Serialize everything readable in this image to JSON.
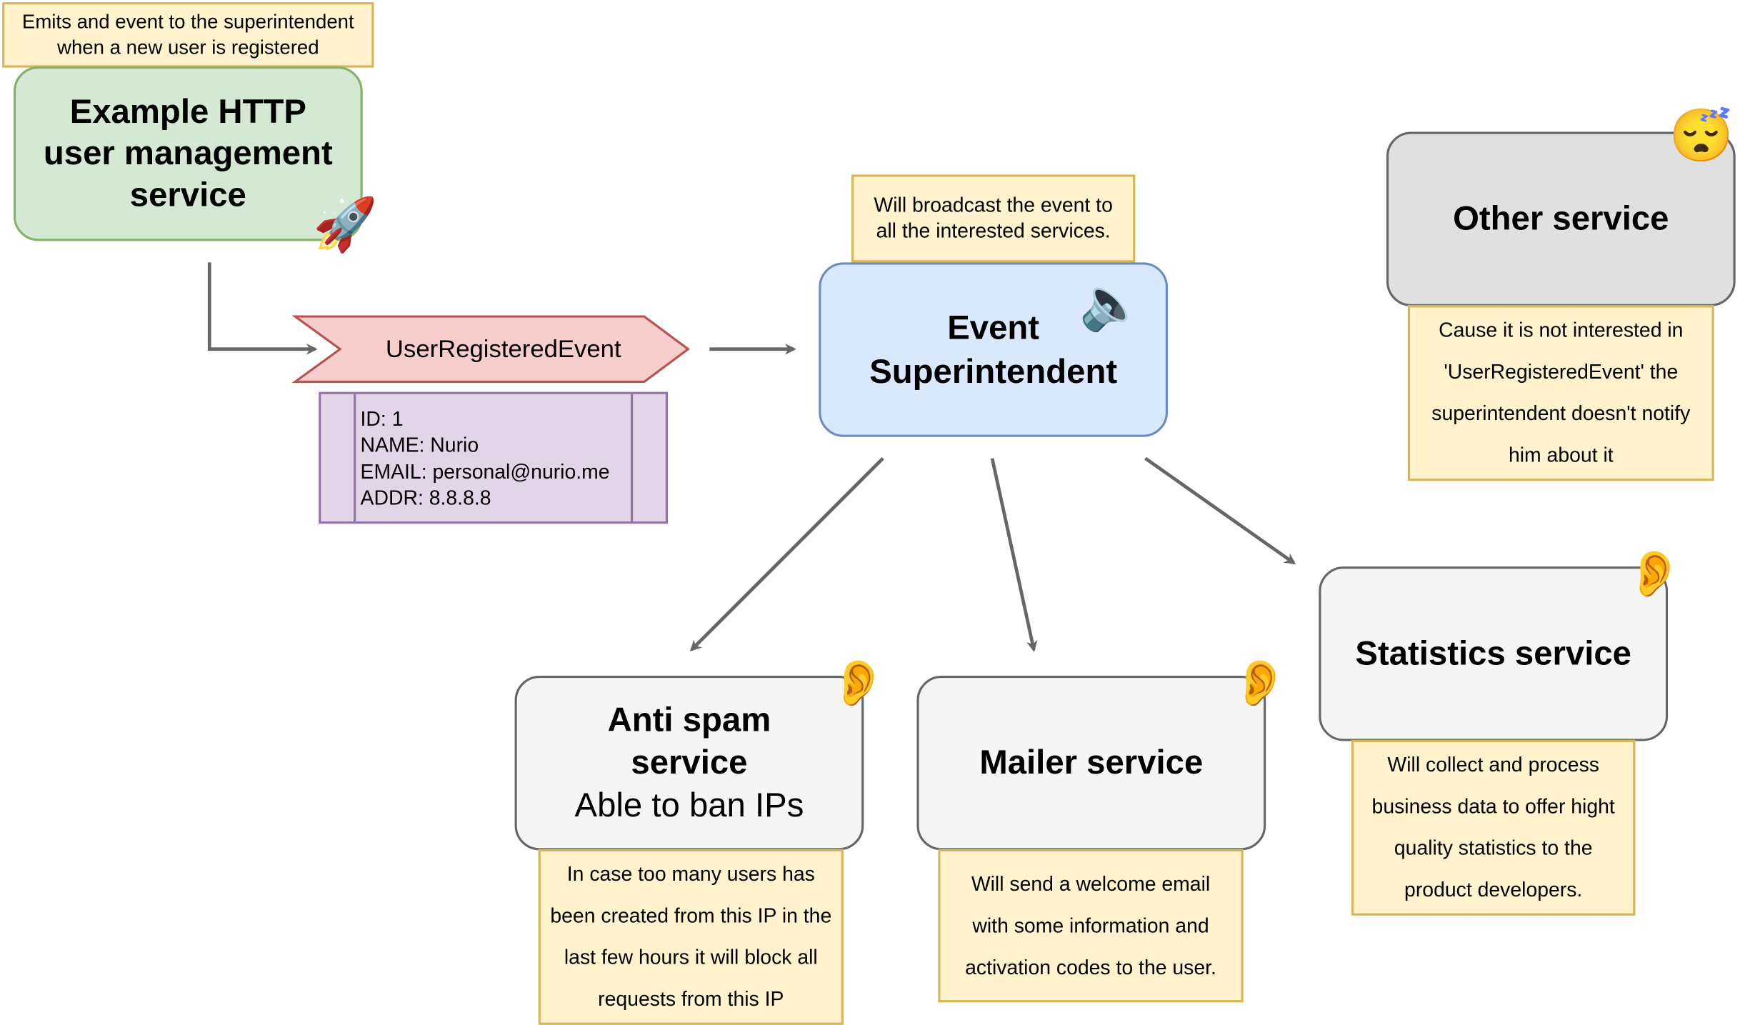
{
  "colors": {
    "note_fill": "#fff2cc",
    "note_stroke": "#d6b656",
    "emitter_fill": "#d5e8d4",
    "emitter_stroke": "#82b366",
    "event_fill": "#f8cecc",
    "event_stroke": "#b85450",
    "payload_fill": "#e1d5e7",
    "payload_stroke": "#9673a6",
    "superintendent_fill": "#dae8fc",
    "superintendent_stroke": "#6c8ebf",
    "service_fill": "#f5f5f5",
    "inactive_fill": "#e0e0e0",
    "arrow": "#666666"
  },
  "emitter": {
    "note": "Emits and event to the superintendent when a new user is registered",
    "title": "Example HTTP user management service",
    "icon": "rocket-icon"
  },
  "event": {
    "name": "UserRegisteredEvent",
    "fields": [
      "ID: 1",
      "NAME: Nurio",
      "EMAIL: personal@nurio.me",
      "ADDR: 8.8.8.8"
    ]
  },
  "superintendent": {
    "note": "Will broadcast the event to all the interested services.",
    "title": "Event Superintendent",
    "icon": "speaker-icon"
  },
  "other": {
    "title": "Other service",
    "icon": "sleeping-face-icon",
    "note": "Cause it is not interested in 'UserRegisteredEvent' the superintendent doesn't notify him about it"
  },
  "antispam": {
    "title": "Anti spam service",
    "subtitle": "Able to ban IPs",
    "icon": "ear-icon",
    "note": "In case too many users has been created from this IP in the last few hours it will block all requests from this IP"
  },
  "mailer": {
    "title": "Mailer service",
    "icon": "ear-icon",
    "note": "Will send a welcome email with some information and activation codes to the user."
  },
  "stats": {
    "title": "Statistics service",
    "icon": "ear-icon",
    "note": "Will collect and process business data to offer hight quality statistics to the product developers."
  }
}
